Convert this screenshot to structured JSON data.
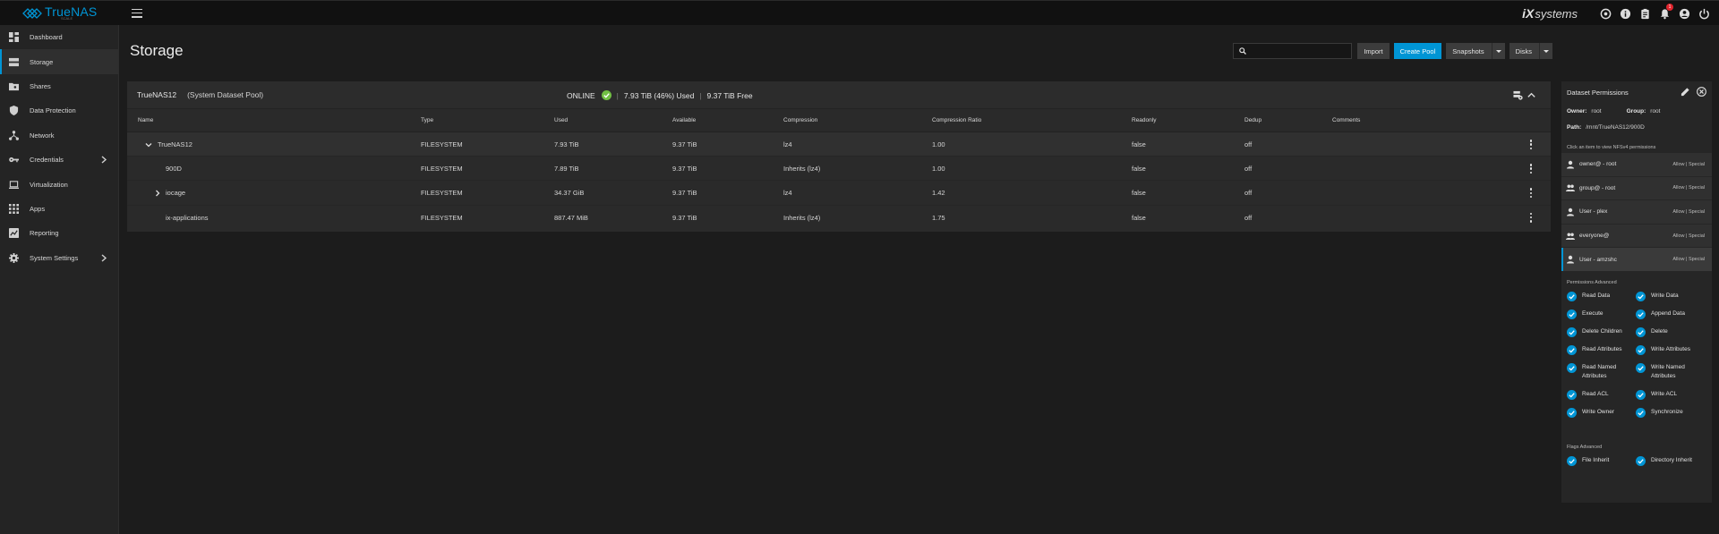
{
  "brand": {
    "name": "TrueNAS",
    "sub": "SCALE"
  },
  "topbar": {
    "vendor_mark": "iX",
    "vendor_name": "systems",
    "notification_count": "1"
  },
  "sidebar": {
    "items": [
      {
        "label": "Dashboard",
        "icon": "dashboard-icon"
      },
      {
        "label": "Storage",
        "icon": "storage-icon",
        "active": true
      },
      {
        "label": "Shares",
        "icon": "folder-share-icon"
      },
      {
        "label": "Data Protection",
        "icon": "shield-icon"
      },
      {
        "label": "Network",
        "icon": "network-icon"
      },
      {
        "label": "Credentials",
        "icon": "key-icon",
        "expandable": true
      },
      {
        "label": "Virtualization",
        "icon": "laptop-icon"
      },
      {
        "label": "Apps",
        "icon": "apps-grid-icon"
      },
      {
        "label": "Reporting",
        "icon": "chart-icon"
      },
      {
        "label": "System Settings",
        "icon": "gear-icon",
        "expandable": true
      }
    ]
  },
  "page": {
    "title": "Storage"
  },
  "toolbar": {
    "search_placeholder": "",
    "import_label": "Import",
    "create_pool_label": "Create Pool",
    "snapshots_label": "Snapshots",
    "disks_label": "Disks"
  },
  "pool": {
    "name": "TrueNAS12",
    "subtitle": "(System Dataset Pool)",
    "status": "ONLINE",
    "used": "7.93 TiB (46%) Used",
    "free": "9.37 TiB Free",
    "sep": "|"
  },
  "table": {
    "headers": {
      "name": "Name",
      "type": "Type",
      "used": "Used",
      "available": "Available",
      "compression": "Compression",
      "compression_ratio": "Compression Ratio",
      "readonly": "Readonly",
      "dedup": "Dedup",
      "comments": "Comments"
    },
    "rows": [
      {
        "name": "TrueNAS12",
        "type": "FILESYSTEM",
        "used": "7.93 TiB",
        "available": "9.37 TiB",
        "compression": "lz4",
        "ratio": "1.00",
        "readonly": "false",
        "dedup": "off"
      },
      {
        "name": "900D",
        "type": "FILESYSTEM",
        "used": "7.89 TiB",
        "available": "9.37 TiB",
        "compression": "Inherits (lz4)",
        "ratio": "1.00",
        "readonly": "false",
        "dedup": "off"
      },
      {
        "name": "iocage",
        "type": "FILESYSTEM",
        "used": "34.37 GiB",
        "available": "9.37 TiB",
        "compression": "lz4",
        "ratio": "1.42",
        "readonly": "false",
        "dedup": "off"
      },
      {
        "name": "ix-applications",
        "type": "FILESYSTEM",
        "used": "887.47 MiB",
        "available": "9.37 TiB",
        "compression": "Inherits (lz4)",
        "ratio": "1.75",
        "readonly": "false",
        "dedup": "off"
      }
    ]
  },
  "permissions": {
    "title": "Dataset Permissions",
    "owner_label": "Owner:",
    "owner": "root",
    "group_label": "Group:",
    "group": "root",
    "path_label": "Path:",
    "path": "/mnt/TrueNAS12/900D",
    "hint": "Click an item to view NFSv4 permissions",
    "aces": [
      {
        "who": "owner@ - root",
        "perm": "Allow | Special",
        "icon": "person-icon"
      },
      {
        "who": "group@ - root",
        "perm": "Allow | Special",
        "icon": "group-icon"
      },
      {
        "who": "User - plex",
        "perm": "Allow | Special",
        "icon": "person-icon"
      },
      {
        "who": "everyone@",
        "perm": "Allow | Special",
        "icon": "group-icon"
      },
      {
        "who": "User - amzshc",
        "perm": "Allow | Special",
        "icon": "person-icon",
        "selected": true
      }
    ],
    "advanced_title": "Permissions Advanced",
    "advanced": [
      "Read Data",
      "Write Data",
      "Execute",
      "Append Data",
      "Delete Children",
      "Delete",
      "Read Attributes",
      "Write Attributes",
      "Read Named Attributes",
      "Write Named Attributes",
      "Read ACL",
      "Write ACL",
      "Write Owner",
      "Synchronize"
    ],
    "flags_title": "Flags Advanced",
    "flags": [
      "File Inherit",
      "Directory Inherit"
    ]
  },
  "colors": {
    "accent": "#0095d5",
    "ok": "#71bf44",
    "badge": "#e0242d"
  }
}
